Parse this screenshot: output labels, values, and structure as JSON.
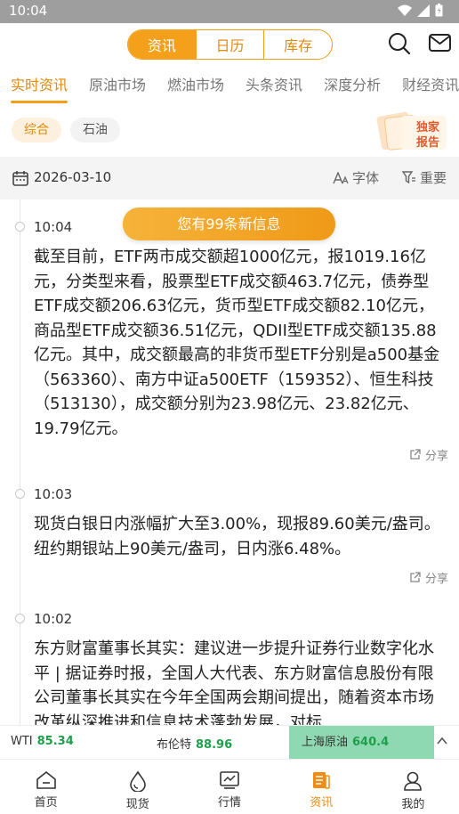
{
  "status_bar": {
    "time": "10:04"
  },
  "header": {
    "segments": [
      "资讯",
      "日历",
      "库存"
    ],
    "active_segment": 0
  },
  "tabs": {
    "items": [
      "实时资讯",
      "原油市场",
      "燃油市场",
      "头条资讯",
      "深度分析",
      "财经资讯"
    ],
    "active": 0
  },
  "chips": {
    "items": [
      "综合",
      "石油"
    ],
    "active": 0
  },
  "exclusive_badge": {
    "line1": "独家",
    "line2": "报告"
  },
  "date_bar": {
    "date": "2026-03-10",
    "font_label": "字体",
    "important_label": "重要"
  },
  "new_message_banner": "您有99条新信息",
  "news": [
    {
      "time": "10:04",
      "body": "截至目前，ETF两市成交额超1000亿元，报1019.16亿元，分类型来看，股票型ETF成交额463.7亿元，债券型ETF成交额206.63亿元，货币型ETF成交额82.10亿元，商品型ETF成交额36.51亿元，QDII型ETF成交额135.88亿元。其中，成交额最高的非货币型ETF分别是a500基金（563360）、南方中证a500ETF（159352）、恒生科技（513130），成交额分别为23.98亿元、23.82亿元、19.79亿元。",
      "share": "分享"
    },
    {
      "time": "10:03",
      "body": "现货白银日内涨幅扩大至3.00%，现报89.60美元/盎司。纽约期银站上90美元/盎司，日内涨6.48%。",
      "share": "分享"
    },
    {
      "time": "10:02",
      "body": "东方财富董事长其实：建议进一步提升证券行业数字化水平 | 据证券时报，全国人大代表、东方财富信息股份有限公司董事长其实在今年全国两会期间提出，随着资本市场改革纵深推进和信息技术蓬勃发展，对标",
      "share": "分享"
    }
  ],
  "ticker": [
    {
      "name": "WTI",
      "value": "85.34"
    },
    {
      "name": "布伦特",
      "value": "88.96"
    },
    {
      "name": "上海原油",
      "value": "640.4"
    }
  ],
  "bottom_nav": {
    "items": [
      "首页",
      "现货",
      "行情",
      "资讯",
      "我的"
    ],
    "active": 3
  },
  "colors": {
    "accent": "#f5a01a",
    "up_green": "#1ea04a",
    "ticker_highlight": "#8fd9b2"
  }
}
